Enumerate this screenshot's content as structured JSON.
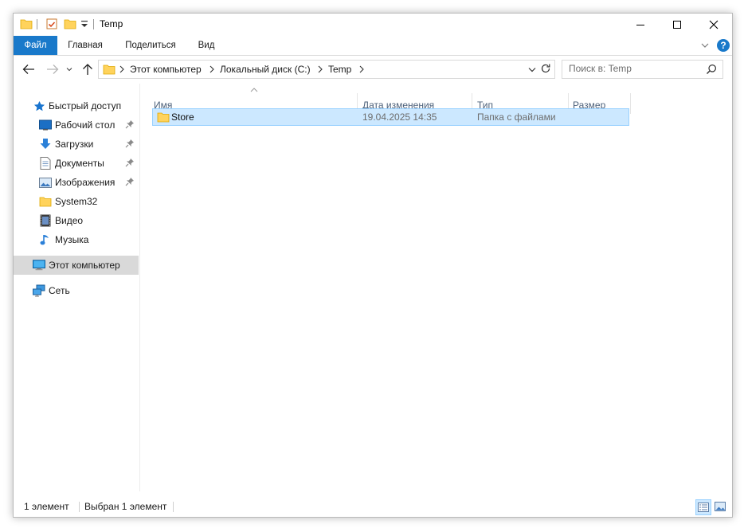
{
  "window": {
    "title": "Temp"
  },
  "quick_access_toolbar": {
    "icons": [
      "folder-icon",
      "properties-icon",
      "new-folder-icon",
      "customize-dropdown-icon"
    ]
  },
  "window_controls": {
    "minimize": "minimize-icon",
    "maximize": "maximize-icon",
    "close": "close-icon"
  },
  "ribbon": {
    "tabs": [
      {
        "label": "Файл",
        "active": true
      },
      {
        "label": "Главная",
        "active": false
      },
      {
        "label": "Поделиться",
        "active": false
      },
      {
        "label": "Вид",
        "active": false
      }
    ],
    "expand_icon": "chevron-down-icon",
    "help_icon": "help-icon"
  },
  "navigation": {
    "back": "back-arrow-icon",
    "forward": "forward-arrow-icon",
    "recent": "chevron-down-icon",
    "up": "up-arrow-icon"
  },
  "address_bar": {
    "breadcrumbs": [
      "Этот компьютер",
      "Локальный диск (C:)",
      "Temp"
    ]
  },
  "search": {
    "placeholder": "Поиск в: Temp"
  },
  "nav_pane": {
    "quick_access": {
      "label": "Быстрый доступ"
    },
    "items": [
      {
        "label": "Рабочий стол",
        "icon": "desktop-icon",
        "pinned": true
      },
      {
        "label": "Загрузки",
        "icon": "downloads-icon",
        "pinned": true
      },
      {
        "label": "Документы",
        "icon": "documents-icon",
        "pinned": true
      },
      {
        "label": "Изображения",
        "icon": "pictures-icon",
        "pinned": true
      },
      {
        "label": "System32",
        "icon": "folder-icon",
        "pinned": false
      },
      {
        "label": "Видео",
        "icon": "videos-icon",
        "pinned": false
      },
      {
        "label": "Музыка",
        "icon": "music-icon",
        "pinned": false
      }
    ],
    "this_pc": {
      "label": "Этот компьютер"
    },
    "network": {
      "label": "Сеть"
    }
  },
  "file_list": {
    "columns": [
      "Имя",
      "Дата изменения",
      "Тип",
      "Размер"
    ],
    "sort_indicator": "sort-up-icon",
    "rows": [
      {
        "name": "Store",
        "modified": "19.04.2025 14:35",
        "type": "Папка с файлами",
        "size": ""
      }
    ]
  },
  "status_bar": {
    "count": "1 элемент",
    "selection": "Выбран 1 элемент"
  },
  "colors": {
    "accent": "#1979ca",
    "selection_bg": "#cce8ff",
    "selection_border": "#99d1ff",
    "folder_yellow": "#ffd35c",
    "header_text": "#4c607a",
    "nav_selected": "#d9d9d9"
  }
}
